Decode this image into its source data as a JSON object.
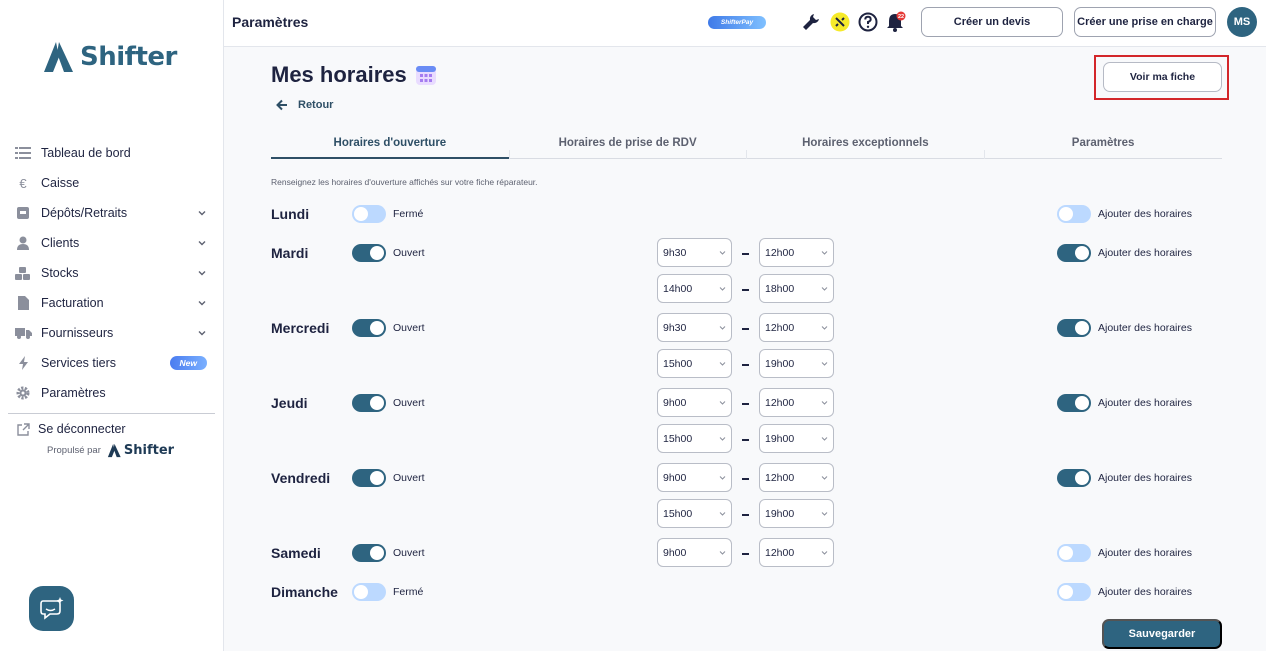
{
  "brand": {
    "name": "Shifter",
    "accent": "#2e6480"
  },
  "sidebar": {
    "items": [
      {
        "label": "Tableau de bord",
        "icon": "list-icon"
      },
      {
        "label": "Caisse",
        "icon": "euro-icon"
      },
      {
        "label": "Dépôts/Retraits",
        "icon": "box-icon"
      },
      {
        "label": "Clients",
        "icon": "user-icon"
      },
      {
        "label": "Stocks",
        "icon": "boxes-icon"
      },
      {
        "label": "Facturation",
        "icon": "file-icon"
      },
      {
        "label": "Fournisseurs",
        "icon": "truck-icon"
      },
      {
        "label": "Services tiers",
        "icon": "bolt-icon",
        "badge": "New"
      },
      {
        "label": "Paramètres",
        "icon": "gear-icon"
      }
    ],
    "logout": "Se déconnecter",
    "powered_by": "Propulsé par",
    "powered_brand": "Shifter"
  },
  "topbar": {
    "title": "Paramètres",
    "shifterpay": "ShifterPay",
    "notification_count": "22",
    "create_quote": "Créer un devis",
    "create_intake": "Créer une prise en charge",
    "avatar_initials": "MS"
  },
  "page": {
    "title": "Mes horaires",
    "back": "Retour",
    "view_profile": "Voir ma fiche",
    "hint": "Renseignez les horaires d'ouverture affichés sur votre fiche réparateur.",
    "save": "Sauvegarder"
  },
  "tabs": [
    {
      "label": "Horaires d'ouverture",
      "active": true
    },
    {
      "label": "Horaires de prise de RDV",
      "active": false
    },
    {
      "label": "Horaires exceptionnels",
      "active": false
    },
    {
      "label": "Paramètres",
      "active": false
    }
  ],
  "add_hours_label": "Ajouter des horaires",
  "days": [
    {
      "name": "Lundi",
      "open": false,
      "status": "Fermé",
      "add_hours": false,
      "slots": []
    },
    {
      "name": "Mardi",
      "open": true,
      "status": "Ouvert",
      "add_hours": true,
      "slots": [
        [
          "9h30",
          "12h00"
        ],
        [
          "14h00",
          "18h00"
        ]
      ]
    },
    {
      "name": "Mercredi",
      "open": true,
      "status": "Ouvert",
      "add_hours": true,
      "slots": [
        [
          "9h30",
          "12h00"
        ],
        [
          "15h00",
          "19h00"
        ]
      ]
    },
    {
      "name": "Jeudi",
      "open": true,
      "status": "Ouvert",
      "add_hours": true,
      "slots": [
        [
          "9h00",
          "12h00"
        ],
        [
          "15h00",
          "19h00"
        ]
      ]
    },
    {
      "name": "Vendredi",
      "open": true,
      "status": "Ouvert",
      "add_hours": true,
      "slots": [
        [
          "9h00",
          "12h00"
        ],
        [
          "15h00",
          "19h00"
        ]
      ]
    },
    {
      "name": "Samedi",
      "open": true,
      "status": "Ouvert",
      "add_hours": false,
      "slots": [
        [
          "9h00",
          "12h00"
        ]
      ]
    },
    {
      "name": "Dimanche",
      "open": false,
      "status": "Fermé",
      "add_hours": false,
      "slots": []
    }
  ]
}
